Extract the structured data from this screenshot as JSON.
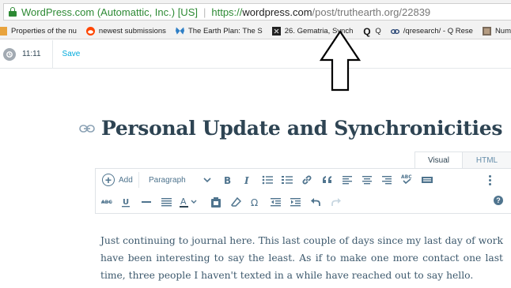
{
  "browser": {
    "site_identity": "WordPress.com (Automattic, Inc.) [US]",
    "url_scheme": "https://",
    "url_host": "wordpress.com",
    "url_path": "/post/truthearth.org/22839"
  },
  "bookmarks": [
    {
      "icon": "bookmark-icon",
      "label": "Properties of the nu"
    },
    {
      "icon": "reddit-icon",
      "label": "newest submissions"
    },
    {
      "icon": "butterfly-icon",
      "label": "The Earth Plan: The S"
    },
    {
      "icon": "gematria-icon",
      "label": "26. Gematria, Synch"
    },
    {
      "icon": "q-icon",
      "label": "Q"
    },
    {
      "icon": "link-icon",
      "label": "/qresearch/ - Q Rese"
    },
    {
      "icon": "image-icon",
      "label": "Number"
    }
  ],
  "editor": {
    "time": "11:11",
    "save_label": "Save",
    "post_title": "Personal Update and Synchronicities",
    "tabs": {
      "visual": "Visual",
      "html": "HTML"
    },
    "toolbar": {
      "add_label": "Add",
      "format_label": "Paragraph"
    },
    "body": "Just continuing to journal here. This last couple of days since my last day of work have been interesting to say the least. As if to make one more contact one last time, three people I haven't texted in a while have reached out to say hello."
  },
  "colors": {
    "accent": "#00aadc",
    "title": "#2e4453",
    "icon": "#4f748e",
    "secure": "#2d8a34"
  }
}
